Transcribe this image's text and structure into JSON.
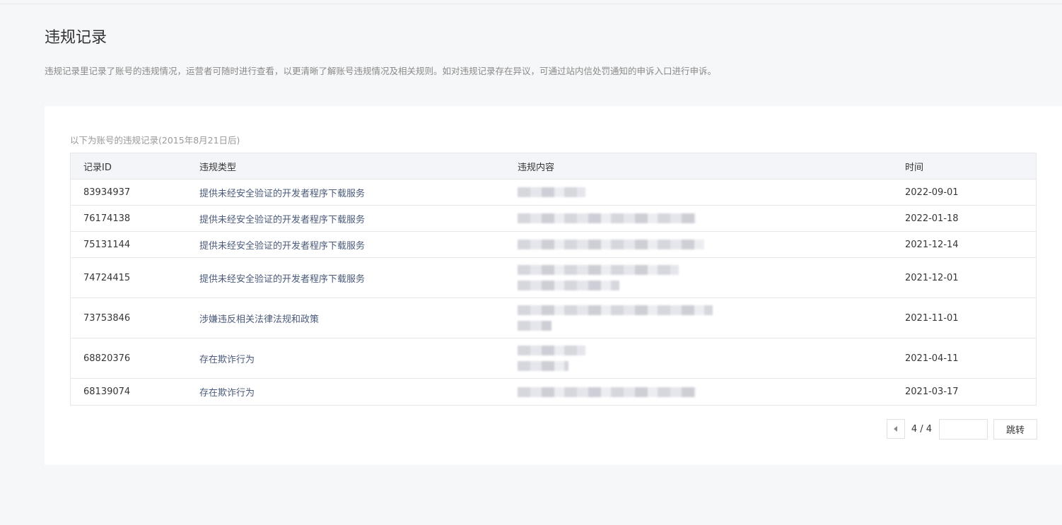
{
  "page": {
    "title": "违规记录",
    "description": "违规记录里记录了账号的违规情况，运营者可随时进行查看，以更清晰了解账号违规情况及相关规则。如对违规记录存在异议，可通过站内信处罚通知的申诉入口进行申诉。"
  },
  "card": {
    "caption": "以下为账号的违规记录(2015年8月21日后)"
  },
  "table": {
    "headers": [
      "记录ID",
      "违规类型",
      "违规内容",
      "时间"
    ],
    "rows": [
      {
        "id": "83934937",
        "type": "提供未经安全验证的开发者程序下载服务",
        "content_lines": 1,
        "time": "2022-09-01"
      },
      {
        "id": "76174138",
        "type": "提供未经安全验证的开发者程序下载服务",
        "content_lines": 1,
        "time": "2022-01-18"
      },
      {
        "id": "75131144",
        "type": "提供未经安全验证的开发者程序下载服务",
        "content_lines": 1,
        "time": "2021-12-14"
      },
      {
        "id": "74724415",
        "type": "提供未经安全验证的开发者程序下载服务",
        "content_lines": 2,
        "time": "2021-12-01"
      },
      {
        "id": "73753846",
        "type": "涉嫌违反相关法律法规和政策",
        "content_lines": 2,
        "time": "2021-11-01"
      },
      {
        "id": "68820376",
        "type": "存在欺诈行为",
        "content_lines": 2,
        "time": "2021-04-11"
      },
      {
        "id": "68139074",
        "type": "存在欺诈行为",
        "content_lines": 1,
        "time": "2021-03-17"
      }
    ]
  },
  "pager": {
    "page_text": "4 / 4",
    "input_value": "",
    "go_label": "跳转",
    "prev_icon": "caret-left-icon"
  }
}
